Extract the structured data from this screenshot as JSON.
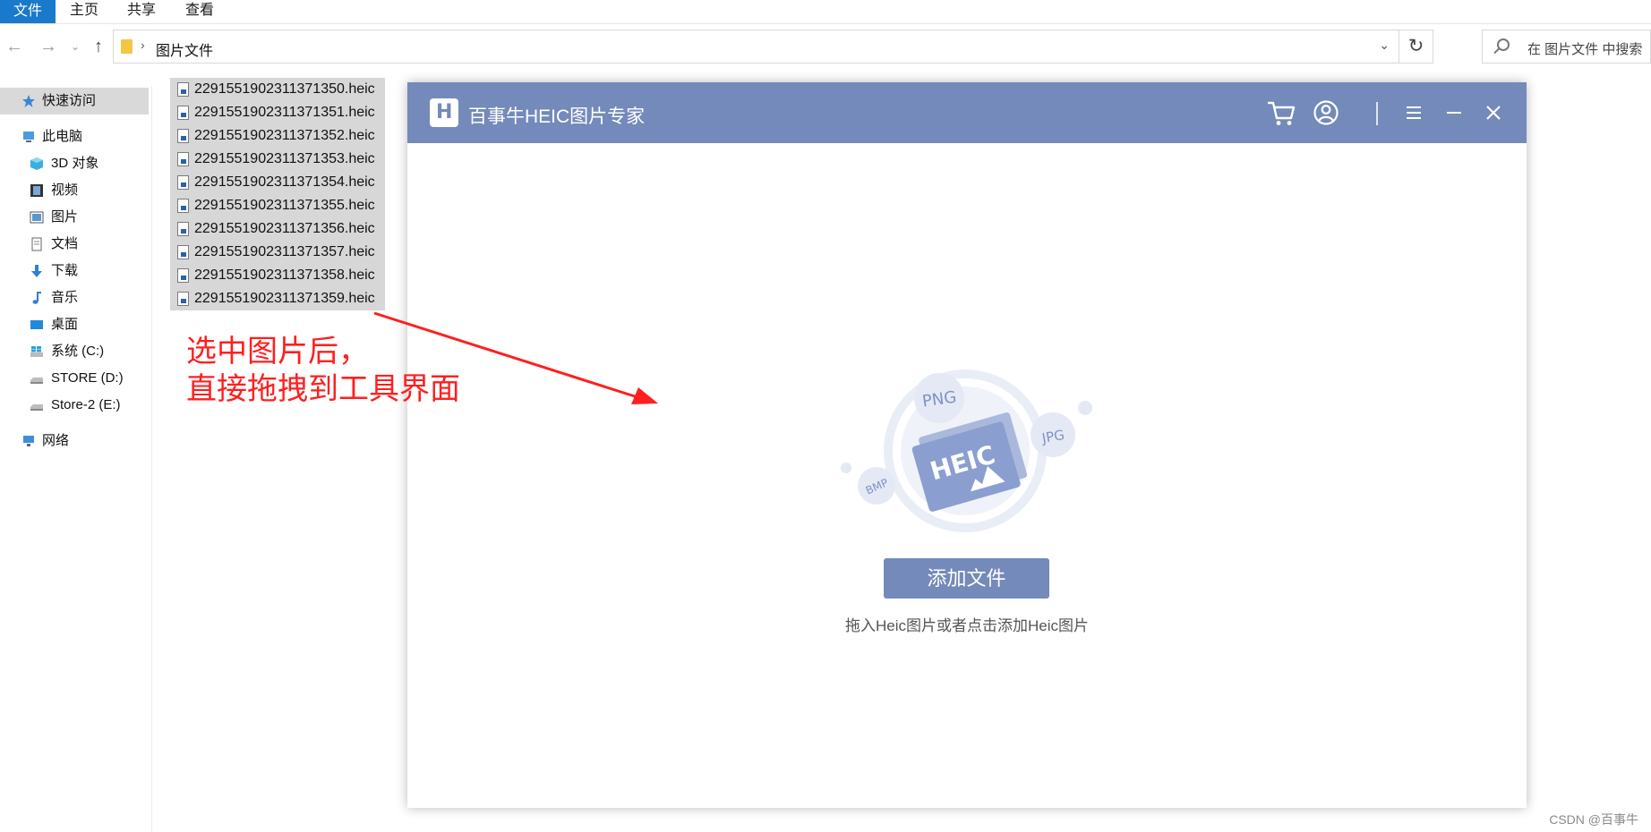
{
  "ribbon": {
    "tabs": [
      "文件",
      "主页",
      "共享",
      "查看"
    ]
  },
  "address": {
    "path": "图片文件",
    "search_placeholder": "在 图片文件 中搜索"
  },
  "nav": {
    "quick_access": "快速访问",
    "this_pc": "此电脑",
    "items": [
      "3D 对象",
      "视频",
      "图片",
      "文档",
      "下载",
      "音乐",
      "桌面",
      "系统 (C:)",
      "STORE (D:)",
      "Store-2 (E:)"
    ],
    "network": "网络"
  },
  "files": [
    "2291551902311371350.heic",
    "2291551902311371351.heic",
    "2291551902311371352.heic",
    "2291551902311371353.heic",
    "2291551902311371354.heic",
    "2291551902311371355.heic",
    "2291551902311371356.heic",
    "2291551902311371357.heic",
    "2291551902311371358.heic",
    "2291551902311371359.heic"
  ],
  "annotation": {
    "line1": "选中图片后，",
    "line2": "直接拖拽到工具界面"
  },
  "app": {
    "title": "百事牛HEIC图片专家",
    "logo_letter": "H",
    "illustration": {
      "center": "HEIC",
      "badges": [
        "PNG",
        "JPG",
        "BMP"
      ]
    },
    "add_button": "添加文件",
    "hint": "拖入Heic图片或者点击添加Heic图片"
  },
  "watermark": "CSDN @百事牛",
  "colors": {
    "app_accent": "#738aba",
    "explorer_file_tab": "#1979ca",
    "annotation": "#ff1f1f"
  }
}
